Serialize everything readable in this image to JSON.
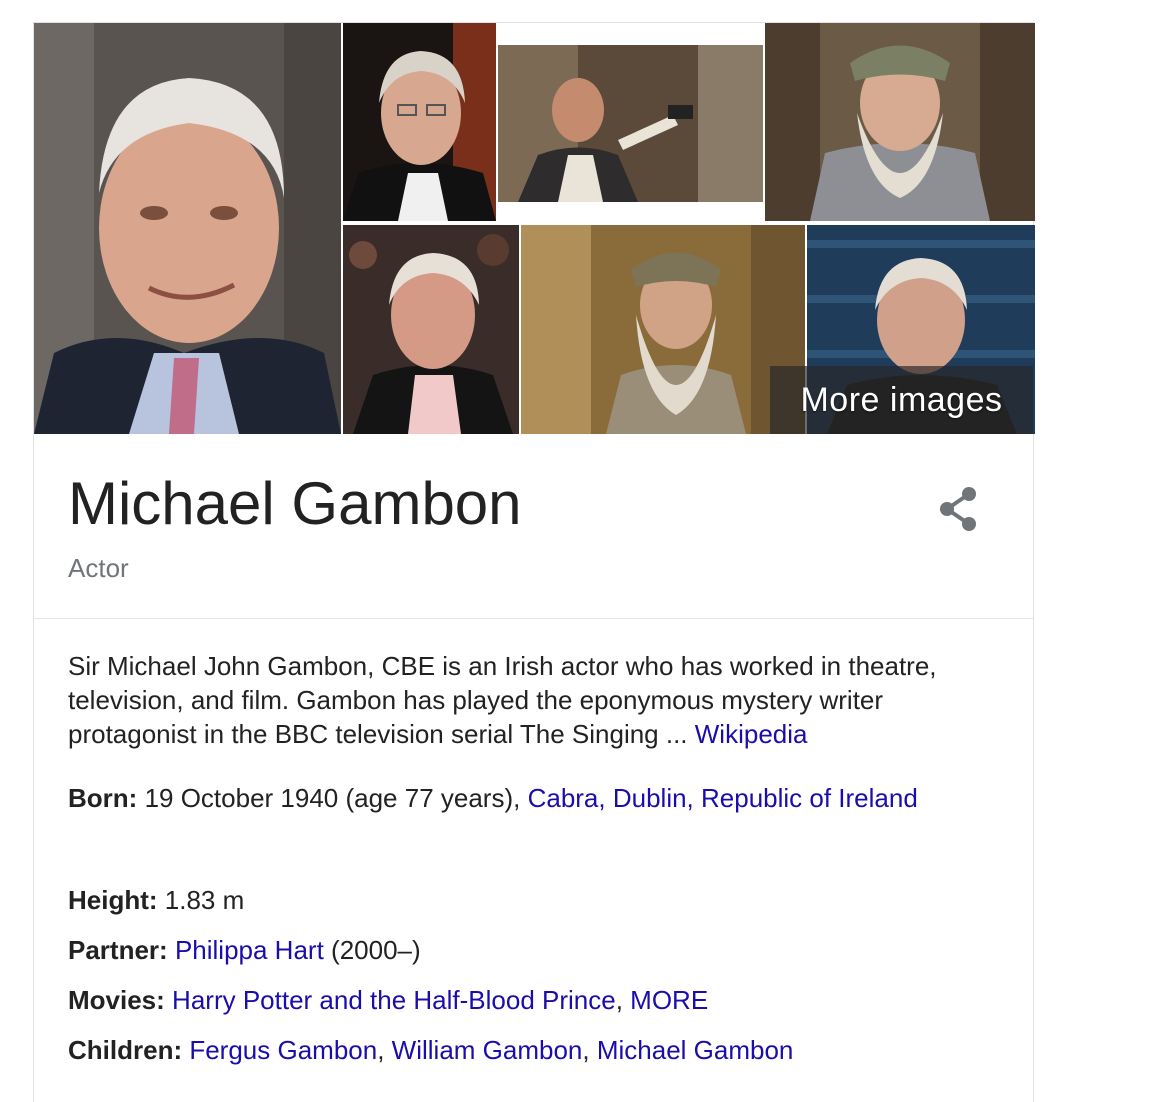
{
  "panel": {
    "title": "Michael Gambon",
    "subtitle": "Actor",
    "more_images_label": "More images",
    "description": "Sir Michael John Gambon, CBE is an Irish actor who has worked in theatre, television, and film. Gambon has played the eponymous mystery writer protagonist in the BBC television serial The Singing ...",
    "description_source": "Wikipedia",
    "share_icon": "share-icon"
  },
  "facts": {
    "born": {
      "label": "Born:",
      "text": "19 October 1940 (age 77 years), ",
      "link": "Cabra, Dublin, Republic of Ireland"
    },
    "height": {
      "label": "Height:",
      "text": "1.83 m"
    },
    "partner": {
      "label": "Partner:",
      "link": "Philippa Hart",
      "text": "(2000–)"
    },
    "movies": {
      "label": "Movies:",
      "link1": "Harry Potter and the Half-Blood Prince",
      "sep": ", ",
      "link2": "MORE"
    },
    "children": {
      "label": "Children:",
      "link1": "Fergus Gambon",
      "sep1": ", ",
      "link2": "William Gambon",
      "sep2": ", ",
      "link3": "Michael Gambon"
    }
  },
  "colors": {
    "link": "#1a0dab",
    "text": "#222222",
    "subtle": "#70757a"
  }
}
